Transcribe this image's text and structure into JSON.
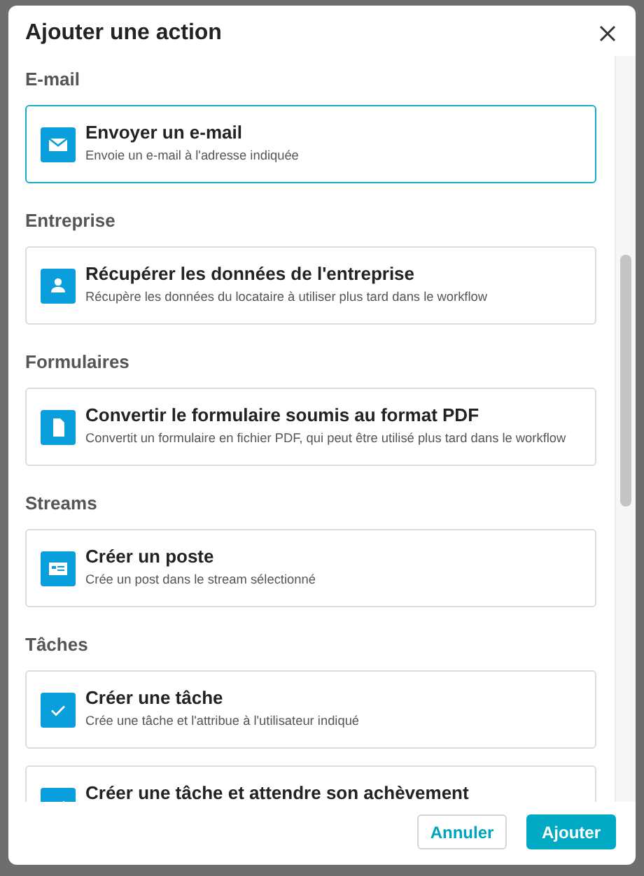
{
  "dialog": {
    "title": "Ajouter une action"
  },
  "sections": [
    {
      "title": "E-mail",
      "actions": [
        {
          "kind": "mail",
          "title": "Envoyer un e-mail",
          "description": "Envoie un e-mail à l'adresse indiquée",
          "selected": true
        }
      ]
    },
    {
      "title": "Entreprise",
      "actions": [
        {
          "kind": "person",
          "title": "Récupérer les données de l'entreprise",
          "description": "Récupère les données du locataire à utiliser plus tard dans le workflow",
          "selected": false
        }
      ]
    },
    {
      "title": "Formulaires",
      "actions": [
        {
          "kind": "file",
          "title": "Convertir le formulaire soumis au format PDF",
          "description": "Convertit un formulaire en fichier PDF, qui peut être utilisé plus tard dans le workflow",
          "selected": false
        }
      ]
    },
    {
      "title": "Streams",
      "actions": [
        {
          "kind": "post",
          "title": "Créer un poste",
          "description": "Crée un post dans le stream sélectionné",
          "selected": false
        }
      ]
    },
    {
      "title": "Tâches",
      "actions": [
        {
          "kind": "check",
          "title": "Créer une tâche",
          "description": "Crée une tâche et l'attribue à l'utilisateur indiqué",
          "selected": false
        },
        {
          "kind": "check",
          "title": "Créer une tâche et attendre son achèvement",
          "selected": false
        }
      ]
    }
  ],
  "buttons": [
    {
      "kind": "secondary",
      "label": "Annuler"
    },
    {
      "kind": "primary",
      "label": "Ajouter"
    }
  ]
}
